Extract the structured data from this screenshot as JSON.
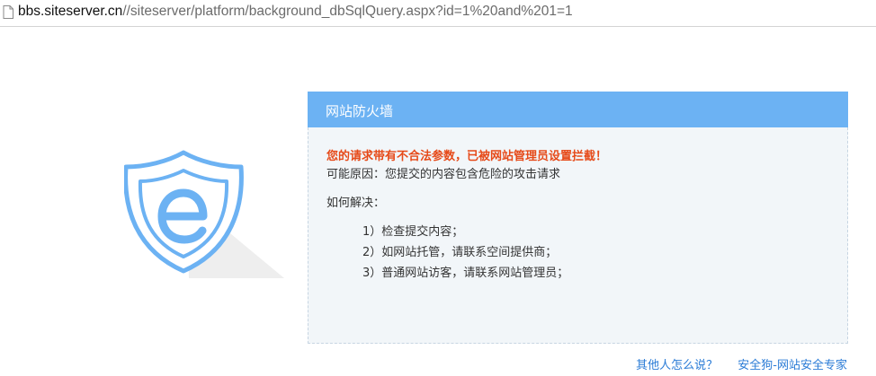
{
  "browser": {
    "url_host": "bbs.siteserver.cn",
    "url_path": "//siteserver/platform/background_dbSqlQuery.aspx?id=1%20and%201=1",
    "icon": "page-icon"
  },
  "logo": {
    "icon": "shield-e-icon",
    "colors": {
      "outline": "#6cb2f3",
      "shadow": "#eeeeee"
    }
  },
  "panel": {
    "title": "网站防火墙",
    "header_color": "#6cb2f3",
    "warning": "您的请求带有不合法参数，已被网站管理员设置拦截！",
    "warning_color": "#e64a19",
    "reason": "可能原因：您提交的内容包含危险的攻击请求",
    "howto_label": "如何解决：",
    "steps": [
      "1）检查提交内容；",
      "2）如网站托管，请联系空间提供商；",
      "3）普通网站访客，请联系网站管理员；"
    ]
  },
  "footer": {
    "links": [
      "其他人怎么说？",
      "安全狗-网站安全专家"
    ],
    "link_color": "#2a7bd6"
  }
}
